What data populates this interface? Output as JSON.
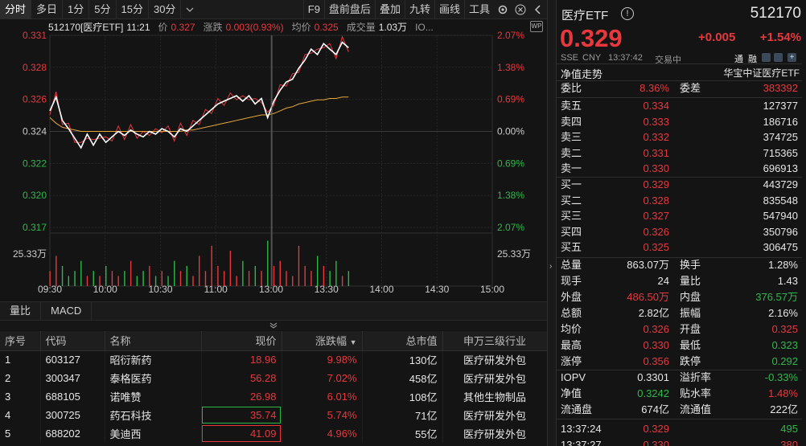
{
  "toolbar": {
    "tabs": [
      "分时",
      "多日",
      "1分",
      "5分",
      "15分",
      "30分"
    ],
    "right_items": [
      "F9",
      "盘前盘后",
      "叠加",
      "九转",
      "画线",
      "工具"
    ]
  },
  "chart": {
    "info": {
      "code_name": "512170[医疗ETF]",
      "time": "11:21",
      "price_label": "价",
      "price": "0.327",
      "change_label": "涨跌",
      "change": "0.003(0.93%)",
      "avg_label": "均价",
      "avg": "0.325",
      "volume_label": "成交量",
      "volume": "1.03万",
      "extra": "IO..."
    },
    "left_axis": [
      "0.331",
      "0.328",
      "0.326",
      "0.324",
      "0.322",
      "0.320",
      "0.317"
    ],
    "right_axis": [
      "2.07%",
      "1.38%",
      "0.69%",
      "0.00%",
      "0.69%",
      "1.38%",
      "2.07%"
    ],
    "vol_label_left": "25.33万",
    "vol_label_right": "25.33万",
    "x_axis": [
      "09:30",
      "10:00",
      "10:30",
      "11:00",
      "13:00",
      "13:30",
      "14:00",
      "14:30",
      "15:00"
    ]
  },
  "chart_data": {
    "type": "line",
    "x": [
      "09:30",
      "10:00",
      "10:30",
      "11:00",
      "13:00",
      "13:30"
    ],
    "series": [],
    "ylim": [
      0.317,
      0.331
    ],
    "x_ticks": [
      "09:30",
      "10:00",
      "10:30",
      "11:00",
      "13:00",
      "13:30",
      "14:00",
      "14:30",
      "15:00"
    ],
    "price_points": [
      0.3255,
      0.3265,
      0.3248,
      0.3242,
      0.3235,
      0.3228,
      0.3238,
      0.323,
      0.3238,
      0.3232,
      0.3236,
      0.324,
      0.3237,
      0.3241,
      0.3238,
      0.3236,
      0.324,
      0.3238,
      0.3242,
      0.324,
      0.3236,
      0.3242,
      0.324,
      0.3244,
      0.3248,
      0.3252,
      0.3256,
      0.326,
      0.3262,
      0.3264,
      0.3266,
      0.3262,
      0.3266,
      0.326,
      0.3264,
      0.325,
      0.3262,
      0.327,
      0.3276,
      0.3278,
      0.3286,
      0.3292,
      0.33,
      0.3296,
      0.3304,
      0.33,
      0.3296,
      0.3305,
      0.3301
    ],
    "avg_points": [
      0.325,
      0.3246,
      0.3243,
      0.3242,
      0.3241,
      0.324,
      0.324,
      0.324,
      0.324,
      0.324,
      0.324,
      0.324,
      0.324,
      0.324,
      0.324,
      0.324,
      0.324,
      0.324,
      0.324,
      0.324,
      0.324,
      0.324,
      0.3241,
      0.3241,
      0.3242,
      0.3243,
      0.3244,
      0.3245,
      0.3246,
      0.3247,
      0.3248,
      0.3249,
      0.325,
      0.3251,
      0.3252,
      0.3252,
      0.3253,
      0.3255,
      0.3257,
      0.3258,
      0.326,
      0.3261,
      0.3262,
      0.3263,
      0.3263,
      0.3264,
      0.3264,
      0.3265,
      0.3265
    ],
    "volume_points": [
      0.3,
      0.6,
      0.4,
      0.2,
      0.3,
      0.5,
      0.2,
      0.3,
      0.2,
      0.4,
      0.3,
      0.2,
      0.3,
      0.5,
      0.2,
      0.3,
      0.4,
      0.2,
      0.3,
      0.2,
      0.5,
      0.3,
      0.4,
      0.2,
      0.6,
      0.3,
      0.8,
      0.4,
      0.3,
      0.7,
      0.2,
      0.5,
      0.3,
      0.4,
      0.3,
      0.9,
      0.4,
      0.5,
      0.3,
      0.2,
      0.8,
      0.4,
      0.3,
      0.6,
      0.4,
      0.3,
      0.5,
      0.2,
      0.3
    ]
  },
  "subtabs": [
    "量比",
    "MACD"
  ],
  "table": {
    "headers": [
      "序号",
      "代码",
      "名称",
      "现价",
      "涨跌幅",
      "总市值",
      "申万三级行业"
    ],
    "sort_indicator": "▼",
    "rows": [
      {
        "no": "1",
        "code": "603127",
        "name": "昭衍新药",
        "price": "18.96",
        "pct": "9.98%",
        "cap": "130亿",
        "ind": "医疗研发外包"
      },
      {
        "no": "2",
        "code": "300347",
        "name": "泰格医药",
        "price": "56.28",
        "pct": "7.02%",
        "cap": "458亿",
        "ind": "医疗研发外包"
      },
      {
        "no": "3",
        "code": "688105",
        "name": "诺唯赞",
        "price": "26.98",
        "pct": "6.01%",
        "cap": "108亿",
        "ind": "其他生物制品"
      },
      {
        "no": "4",
        "code": "300725",
        "name": "药石科技",
        "price": "35.74",
        "pct": "5.74%",
        "cap": "71亿",
        "ind": "医疗研发外包"
      },
      {
        "no": "5",
        "code": "688202",
        "name": "美迪西",
        "price": "41.09",
        "pct": "4.96%",
        "cap": "55亿",
        "ind": "医疗研发外包"
      }
    ]
  },
  "panel": {
    "name": "医疗ETF",
    "code": "512170",
    "price": "0.329",
    "change": "+0.005",
    "pct": "+1.54%",
    "exchange": "SSE",
    "currency": "CNY",
    "time": "13:37:42",
    "status": "交易中",
    "tag1": "通",
    "tag2": "融",
    "nav_label": "净值走势",
    "index_name": "华宝中证医疗ETF",
    "weibi_label": "委比",
    "weibi": "8.36%",
    "weicha_label": "委差",
    "weicha": "383392",
    "asks": [
      {
        "label": "卖五",
        "price": "0.334",
        "vol": "127377"
      },
      {
        "label": "卖四",
        "price": "0.333",
        "vol": "186716"
      },
      {
        "label": "卖三",
        "price": "0.332",
        "vol": "374725"
      },
      {
        "label": "卖二",
        "price": "0.331",
        "vol": "715365"
      },
      {
        "label": "卖一",
        "price": "0.330",
        "vol": "696913"
      }
    ],
    "bids": [
      {
        "label": "买一",
        "price": "0.329",
        "vol": "443729"
      },
      {
        "label": "买二",
        "price": "0.328",
        "vol": "835548"
      },
      {
        "label": "买三",
        "price": "0.327",
        "vol": "547940"
      },
      {
        "label": "买四",
        "price": "0.326",
        "vol": "350796"
      },
      {
        "label": "买五",
        "price": "0.325",
        "vol": "306475"
      }
    ],
    "stats": [
      {
        "k1": "总量",
        "v1": "863.07万",
        "c1": "white",
        "k2": "换手",
        "v2": "1.28%",
        "c2": "white"
      },
      {
        "k1": "现手",
        "v1": "24",
        "c1": "white",
        "k2": "量比",
        "v2": "1.43",
        "c2": "white"
      },
      {
        "k1": "外盘",
        "v1": "486.50万",
        "c1": "red",
        "k2": "内盘",
        "v2": "376.57万",
        "c2": "green"
      },
      {
        "k1": "总额",
        "v1": "2.82亿",
        "c1": "white",
        "k2": "振幅",
        "v2": "2.16%",
        "c2": "white"
      },
      {
        "k1": "均价",
        "v1": "0.326",
        "c1": "red",
        "k2": "开盘",
        "v2": "0.325",
        "c2": "red"
      },
      {
        "k1": "最高",
        "v1": "0.330",
        "c1": "red",
        "k2": "最低",
        "v2": "0.323",
        "c2": "green"
      },
      {
        "k1": "涨停",
        "v1": "0.356",
        "c1": "red",
        "k2": "跌停",
        "v2": "0.292",
        "c2": "green"
      }
    ],
    "stats2": [
      {
        "k1": "IOPV",
        "v1": "0.3301",
        "c1": "white",
        "k2": "溢折率",
        "v2": "-0.33%",
        "c2": "green"
      },
      {
        "k1": "净值",
        "v1": "0.3242",
        "c1": "green",
        "k2": "贴水率",
        "v2": "1.48%",
        "c2": "red"
      },
      {
        "k1": "流通盘",
        "v1": "674亿",
        "c1": "white",
        "k2": "流通值",
        "v2": "222亿",
        "c2": "white"
      }
    ],
    "ticks": [
      {
        "time": "13:37:24",
        "price": "0.329",
        "vol": "495",
        "vcolor": "green"
      },
      {
        "time": "13:37:27",
        "price": "0.330",
        "vol": "380",
        "vcolor": "red"
      }
    ]
  },
  "colors": {
    "red": "#e8383d",
    "green": "#2fb84a",
    "avg_line": "#e8a53a",
    "price_line": "#ffffff"
  }
}
